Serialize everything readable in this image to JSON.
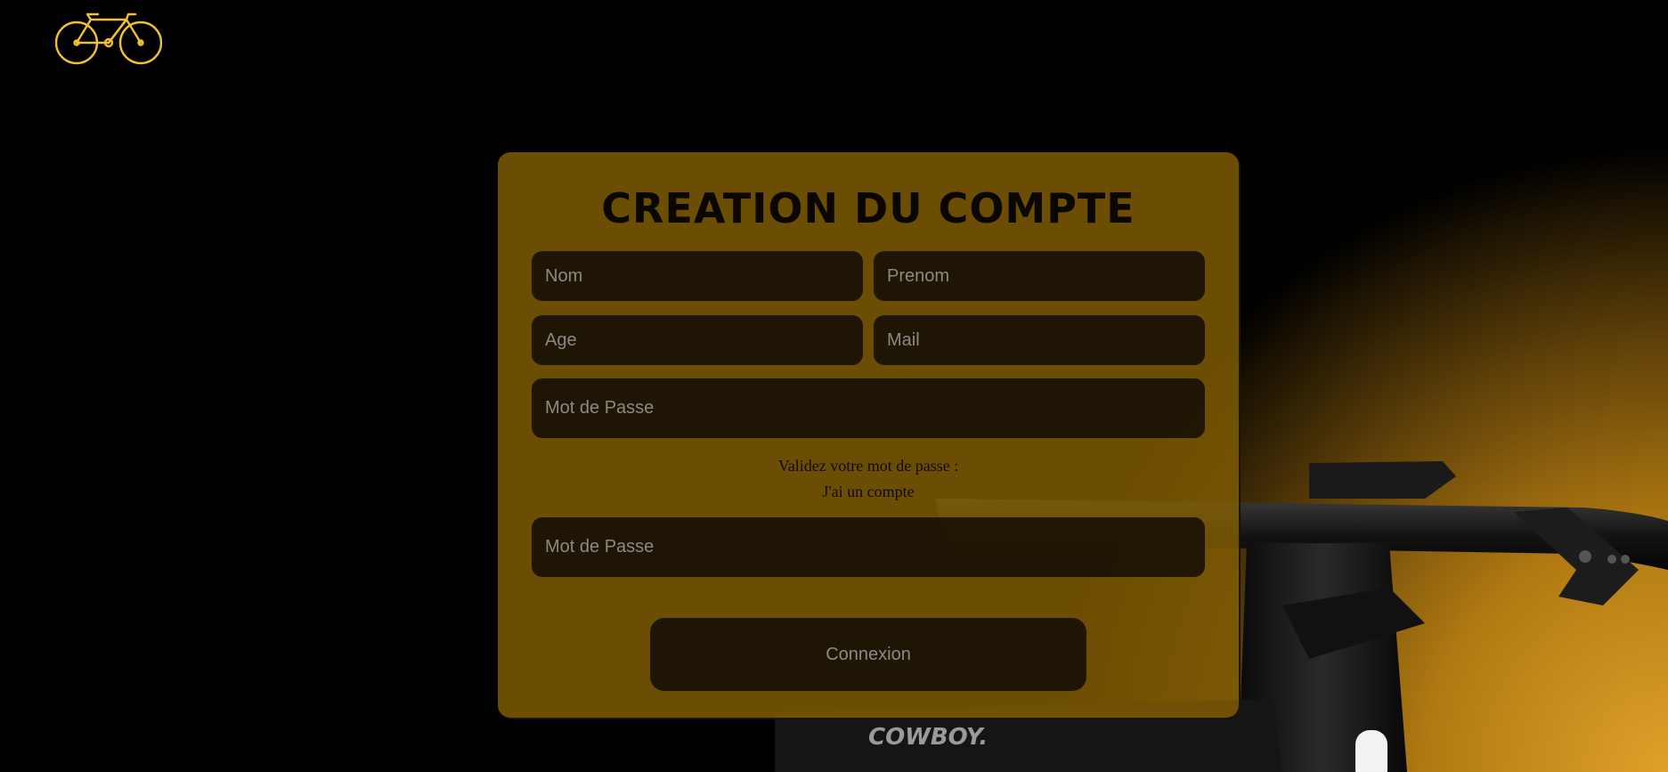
{
  "logo": {
    "icon": "bicycle-icon",
    "color": "#f2c12e"
  },
  "form": {
    "title": "CREATION DU COMPTE",
    "nom_placeholder": "Nom",
    "prenom_placeholder": "Prenom",
    "age_placeholder": "Age",
    "mail_placeholder": "Mail",
    "password_placeholder": "Mot de Passe",
    "validate_label": "Validez votre mot de passe :",
    "have_account_link": "J'ai un compte",
    "confirm_password_placeholder": "Mot de Passe",
    "submit_label": "Connexion"
  },
  "background": {
    "brand_text": "COWBOY.",
    "accent_color": "#e0a12a",
    "card_color": "#835e04"
  }
}
